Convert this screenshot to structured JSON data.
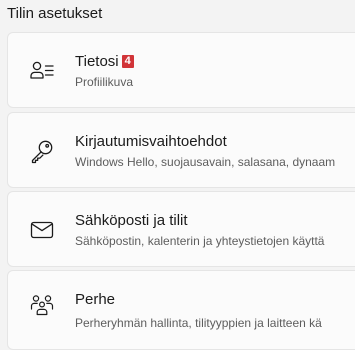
{
  "header": {
    "title": "Tilin asetukset"
  },
  "items": [
    {
      "title": "Tietosi",
      "badge": "4",
      "subtitle": "Profiilikuva",
      "icon": "person-info-icon"
    },
    {
      "title": "Kirjautumisvaihtoehdot",
      "subtitle": "Windows Hello, suojausavain, salasana, dynaam",
      "icon": "key-icon"
    },
    {
      "title": "Sähköposti ja tilit",
      "subtitle": "Sähköpostin, kalenterin ja yhteystietojen käyttä",
      "icon": "mail-icon"
    },
    {
      "title": "Perhe",
      "subtitle": "Perheryhmän hallinta, tilityyppien ja laitteen kä",
      "icon": "family-icon"
    }
  ],
  "colors": {
    "background": "#f3f3f3",
    "card": "#fbfbfb",
    "badge": "#d13438",
    "subtitle": "#5d5d5d"
  }
}
